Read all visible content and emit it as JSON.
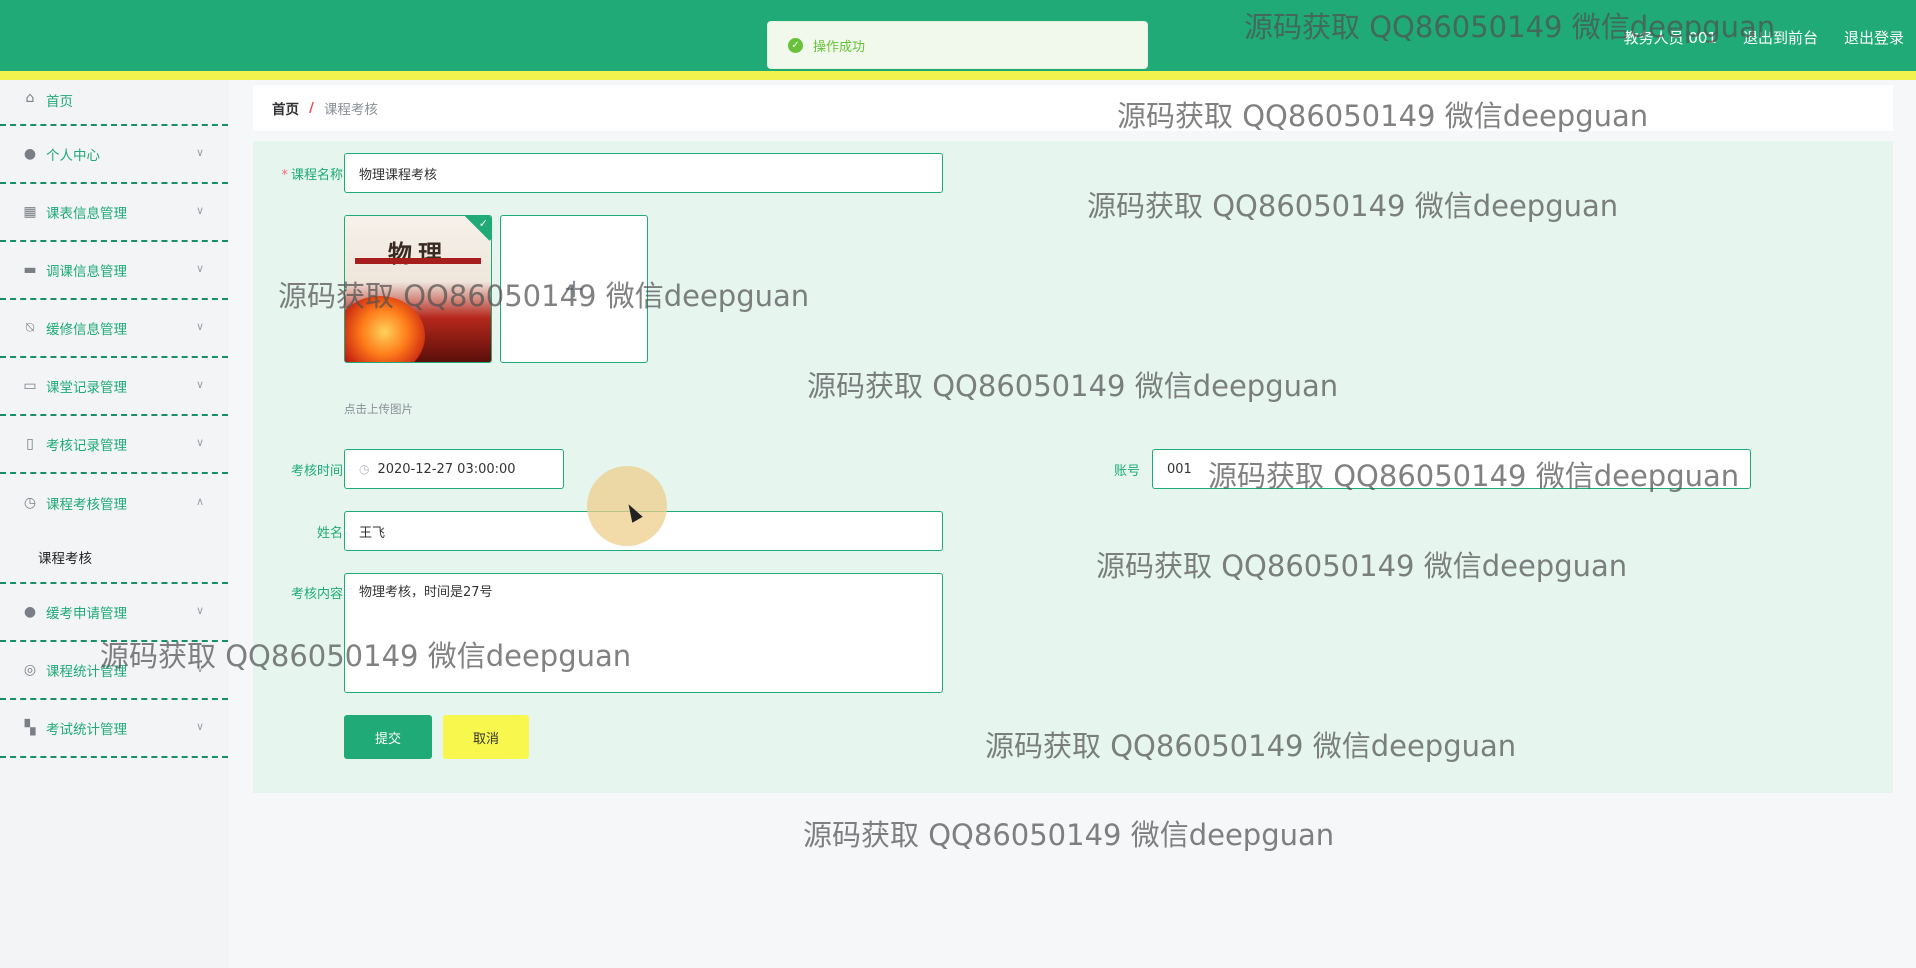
{
  "header": {
    "user": "教务人员 001",
    "front_link": "退出到前台",
    "logout": "退出登录",
    "colors": {
      "primary": "#1faa77",
      "accent_stripe": "#f2f24e"
    }
  },
  "toast": {
    "message": "操作成功",
    "icon": "check-circle-icon"
  },
  "sidebar": {
    "items": [
      {
        "label": "首页",
        "icon": "home-icon"
      },
      {
        "label": "个人中心",
        "icon": "user-icon"
      },
      {
        "label": "课表信息管理",
        "icon": "grid-icon"
      },
      {
        "label": "调课信息管理",
        "icon": "briefcase-icon"
      },
      {
        "label": "缓修信息管理",
        "icon": "bell-off-icon"
      },
      {
        "label": "课堂记录管理",
        "icon": "monitor-icon"
      },
      {
        "label": "考核记录管理",
        "icon": "phone-icon"
      },
      {
        "label": "课程考核管理",
        "icon": "clock-icon"
      },
      {
        "label": "缓考申请管理",
        "icon": "user-icon"
      },
      {
        "label": "课程统计管理",
        "icon": "compass-icon"
      },
      {
        "label": "考试统计管理",
        "icon": "dashboard-icon"
      }
    ],
    "submenu": {
      "label": "课程考核"
    }
  },
  "breadcrumb": {
    "home": "首页",
    "separator": "/",
    "current": "课程考核"
  },
  "form": {
    "course_name": {
      "label": "课程名称",
      "value": "物理课程考核"
    },
    "image": {
      "book_title": "物理",
      "upload_hint": "点击上传图片",
      "plus": "+"
    },
    "exam_time": {
      "label": "考核时间",
      "value": "2020-12-27 03:00:00"
    },
    "account": {
      "label": "账号",
      "value": "001"
    },
    "name": {
      "label": "姓名",
      "value": "王飞"
    },
    "content": {
      "label": "考核内容",
      "value": "物理考核，时间是27号"
    },
    "submit": "提交",
    "cancel": "取消"
  },
  "watermark": "源码获取 QQ86050149 微信deepguan"
}
